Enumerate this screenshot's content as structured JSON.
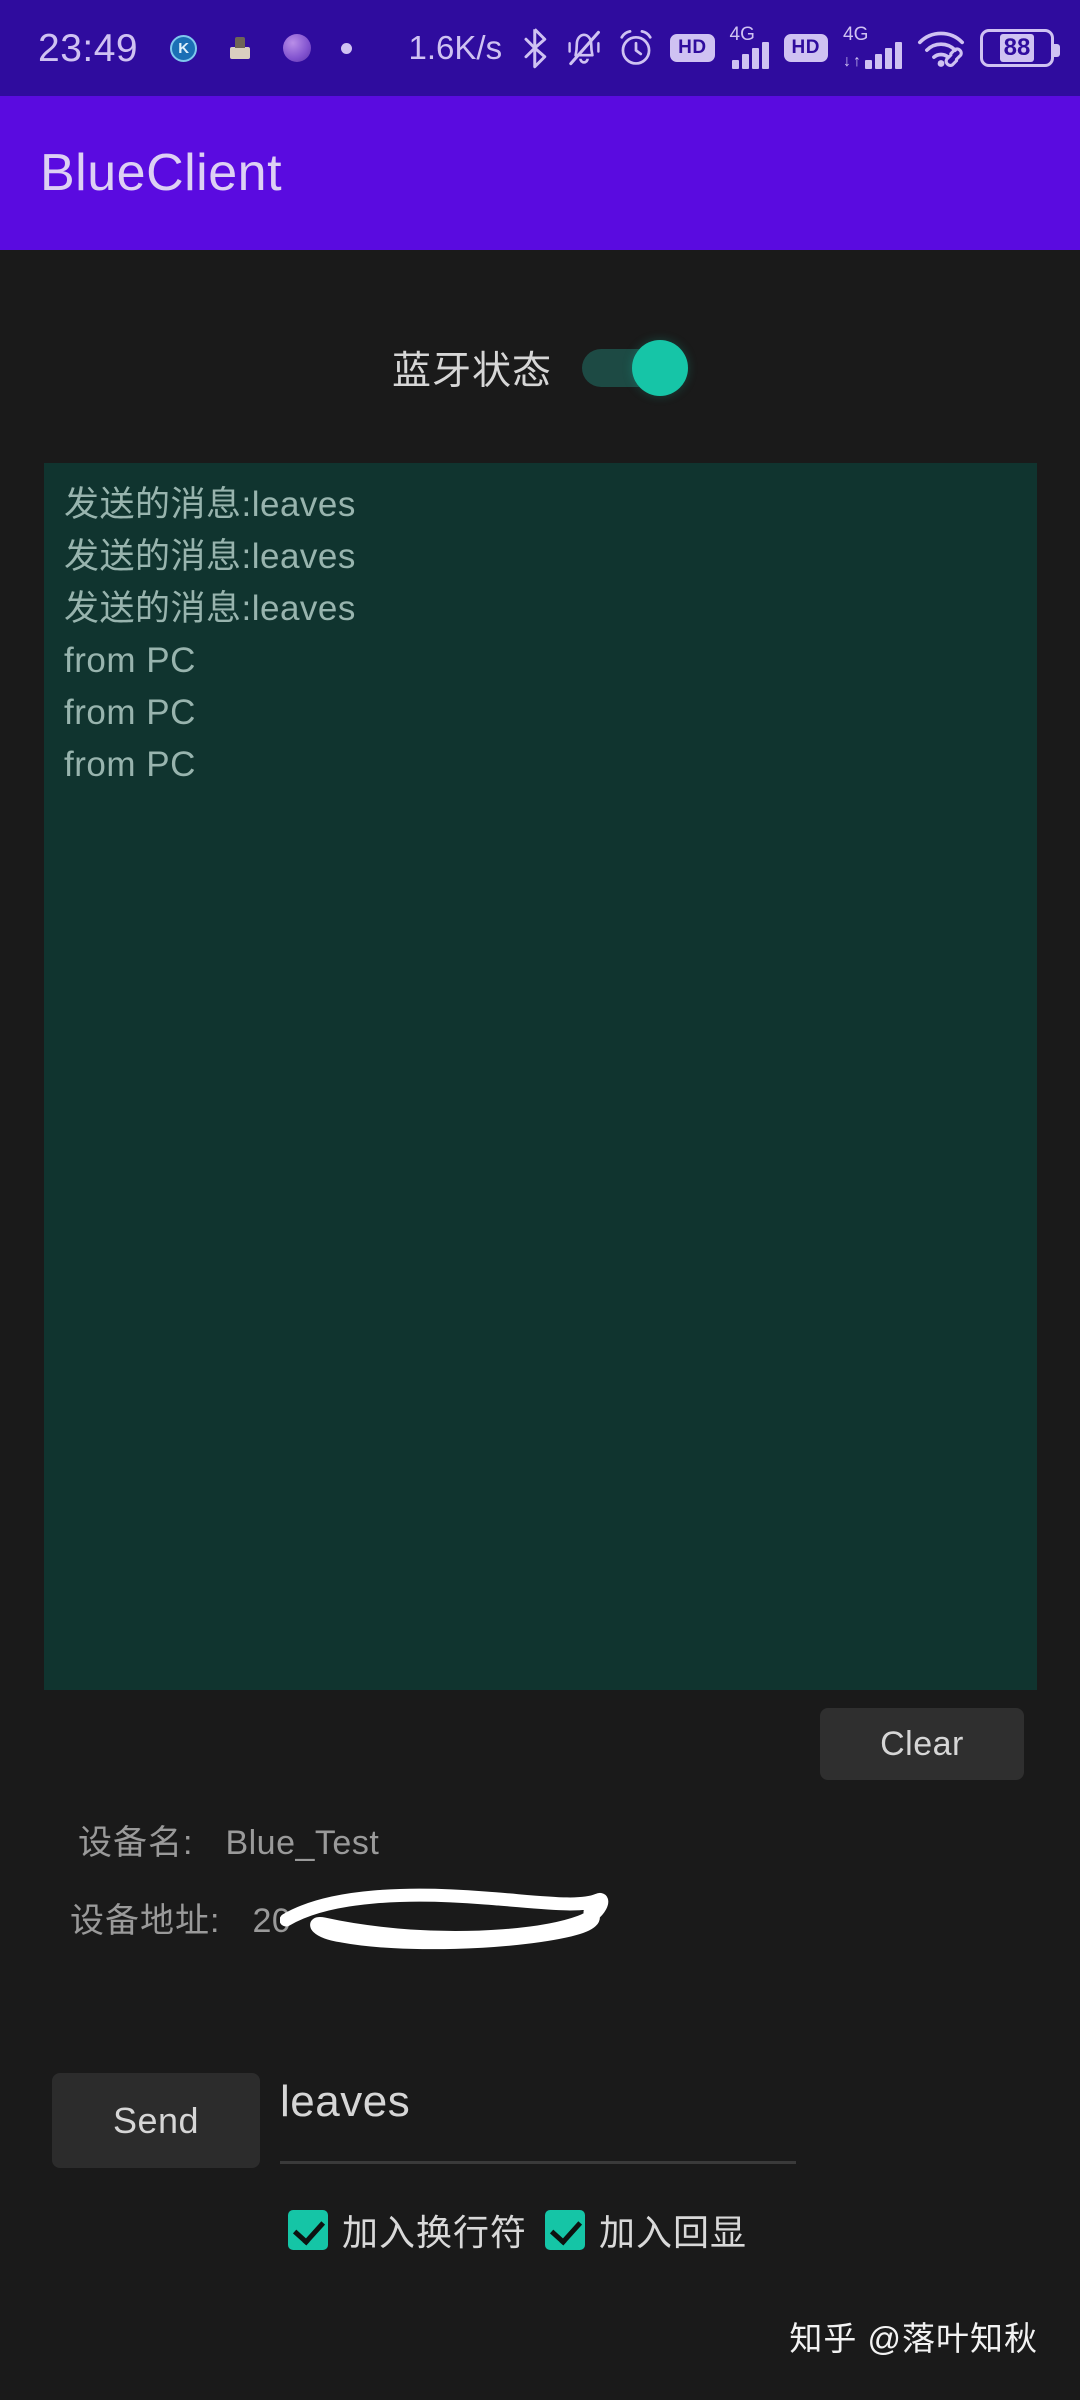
{
  "status_bar": {
    "clock": "23:49",
    "network_speed": "1.6K/s",
    "battery_level": "88",
    "sim1_network": "4G",
    "sim1_hd": "HD",
    "sim2_network": "4G",
    "sim2_hd": "HD",
    "notification_icons": [
      "k-app-icon",
      "package-icon",
      "purple-orb-icon",
      "dot-icon"
    ],
    "right_icons": [
      "bluetooth-icon",
      "mute-bell-icon",
      "alarm-clock-icon",
      "hd-badge-icon",
      "signal-bars-icon",
      "wifi-icon",
      "battery-icon"
    ]
  },
  "app_bar": {
    "title": "BlueClient",
    "background": "#5a0be0",
    "title_color": "#ddd0f4"
  },
  "bluetooth": {
    "label": "蓝牙状态",
    "enabled": true,
    "accent": "#16c5a7",
    "track_color": "#1d4a44"
  },
  "log": {
    "background": "#10342f",
    "text_color": "#98b4ae",
    "lines": [
      "发送的消息:leaves",
      "发送的消息:leaves",
      "发送的消息:leaves",
      "from PC",
      "from PC",
      "from PC"
    ]
  },
  "actions": {
    "clear_label": "Clear",
    "send_label": "Send"
  },
  "device": {
    "name_key": "设备名:",
    "name_value": "Blue_Test",
    "address_key": "设备地址:",
    "address_value": "20",
    "address_redacted": true
  },
  "message_input": {
    "value": "leaves",
    "placeholder": ""
  },
  "options": [
    {
      "label": "加入换行符",
      "checked": true
    },
    {
      "label": "加入回显",
      "checked": true
    }
  ],
  "watermark": {
    "text": "知乎 @落叶知秋"
  }
}
